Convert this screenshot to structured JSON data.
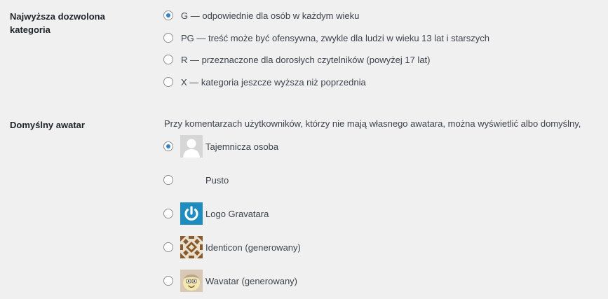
{
  "rating": {
    "label_line1": "Najwyższa dozwolona",
    "label_line2": "kategoria",
    "options": [
      {
        "text": "G — odpowiednie dla osób w każdym wieku",
        "checked": true
      },
      {
        "text": "PG — treść może być ofensywna, zwykle dla ludzi w wieku 13 lat i starszych",
        "checked": false
      },
      {
        "text": "R — przeznaczone dla dorosłych czytelników (powyżej 17 lat)",
        "checked": false
      },
      {
        "text": "X — kategoria jeszcze wyższa niż poprzednia",
        "checked": false
      }
    ]
  },
  "default_avatar": {
    "label": "Domyślny awatar",
    "description": "Przy komentarzach użytkowników, którzy nie mają własnego awatara, można wyświetlić albo domyślny,",
    "options": [
      {
        "label": "Tajemnicza osoba",
        "icon": "mystery-person-icon",
        "checked": true
      },
      {
        "label": "Pusto",
        "icon": "blank-icon",
        "checked": false
      },
      {
        "label": "Logo Gravatara",
        "icon": "gravatar-logo-icon",
        "checked": false
      },
      {
        "label": "Identicon (generowany)",
        "icon": "identicon-icon",
        "checked": false
      },
      {
        "label": "Wavatar (generowany)",
        "icon": "wavatar-icon",
        "checked": false
      }
    ]
  },
  "colors": {
    "background": "#f0f0f1",
    "radio_checked": "#3582c4",
    "gravatar_blue": "#1e8cbe"
  }
}
